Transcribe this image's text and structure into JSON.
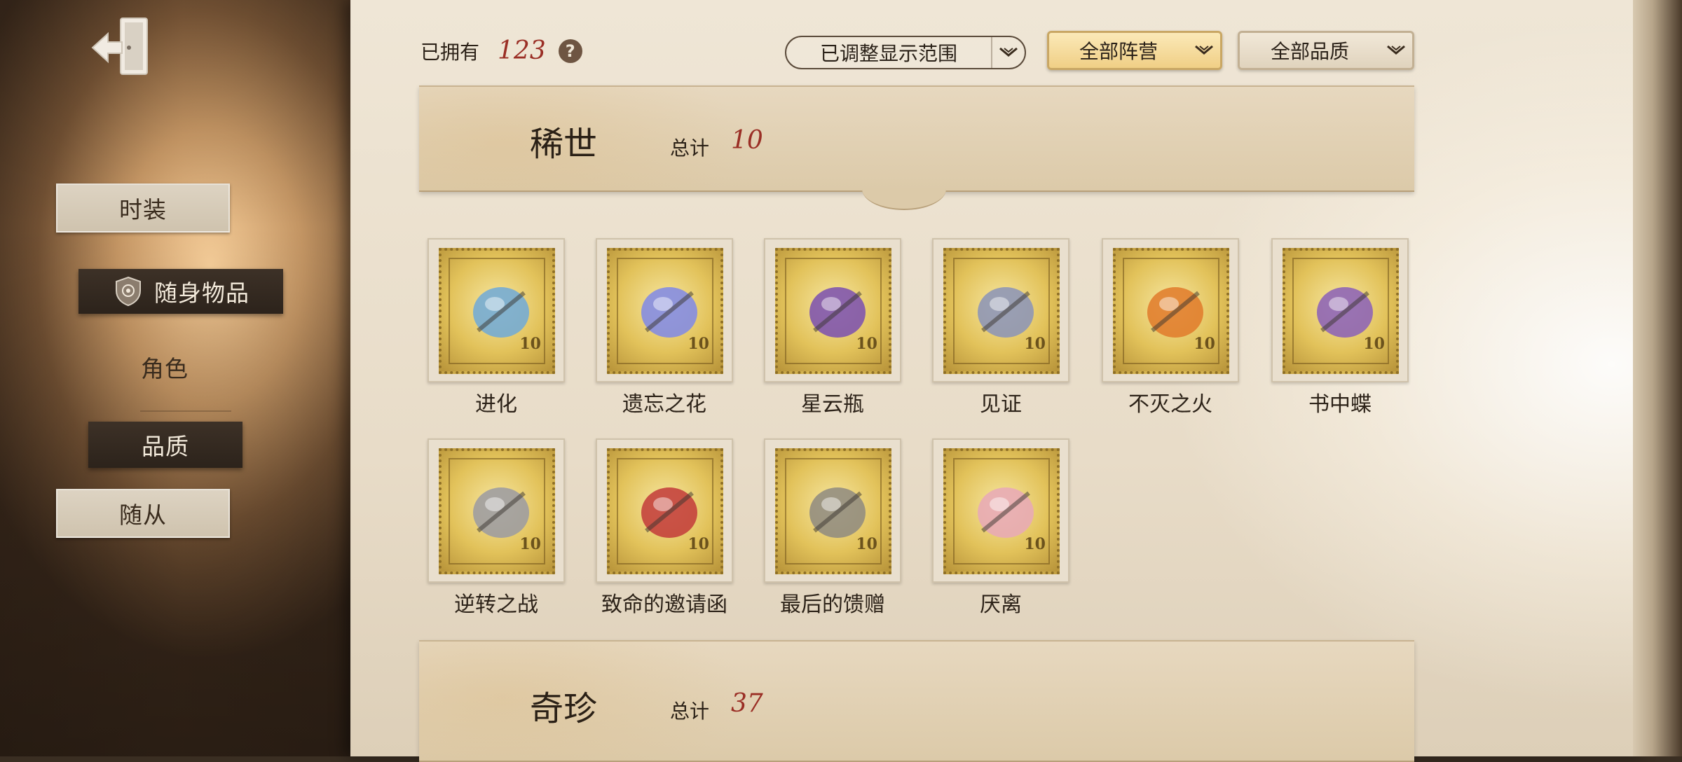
{
  "sidebar": {
    "items": [
      {
        "label": "时装"
      },
      {
        "label": "随身物品"
      },
      {
        "label": "角色"
      },
      {
        "label": "品质"
      },
      {
        "label": "随从"
      }
    ]
  },
  "topbar": {
    "owned_label": "已拥有",
    "owned_count": "123",
    "help": "?",
    "range_dropdown": "已调整显示范围",
    "faction_dropdown": "全部阵营",
    "quality_dropdown": "全部品质"
  },
  "sections": [
    {
      "title": "稀世",
      "total_label": "总计",
      "total": "10",
      "items": [
        {
          "name": "进化",
          "icon": "dna-helix-icon",
          "color": "#6fa9d8"
        },
        {
          "name": "遗忘之花",
          "icon": "crystal-rose-icon",
          "color": "#7f88e8"
        },
        {
          "name": "星云瓶",
          "icon": "nebula-flask-icon",
          "color": "#7a4fb0"
        },
        {
          "name": "见证",
          "icon": "witness-badge-icon",
          "color": "#8a93b8"
        },
        {
          "name": "不灭之火",
          "icon": "torch-icon",
          "color": "#e07a2a"
        },
        {
          "name": "书中蝶",
          "icon": "butterfly-book-icon",
          "color": "#8a5fb8"
        },
        {
          "name": "逆转之战",
          "icon": "winged-helmet-icon",
          "color": "#9a9aa2"
        },
        {
          "name": "致命的邀请函",
          "icon": "winged-letter-icon",
          "color": "#c23a3a"
        },
        {
          "name": "最后的馈赠",
          "icon": "harmonica-icon",
          "color": "#8e8a80"
        },
        {
          "name": "厌离",
          "icon": "sakura-branch-icon",
          "color": "#e8a8b8"
        }
      ],
      "stamp_value": "10"
    },
    {
      "title": "奇珍",
      "total_label": "总计",
      "total": "37"
    }
  ],
  "colors": {
    "accent_red": "#9a2e25",
    "stamp_gold": "#e2c25a",
    "paper": "#efe6d6"
  }
}
